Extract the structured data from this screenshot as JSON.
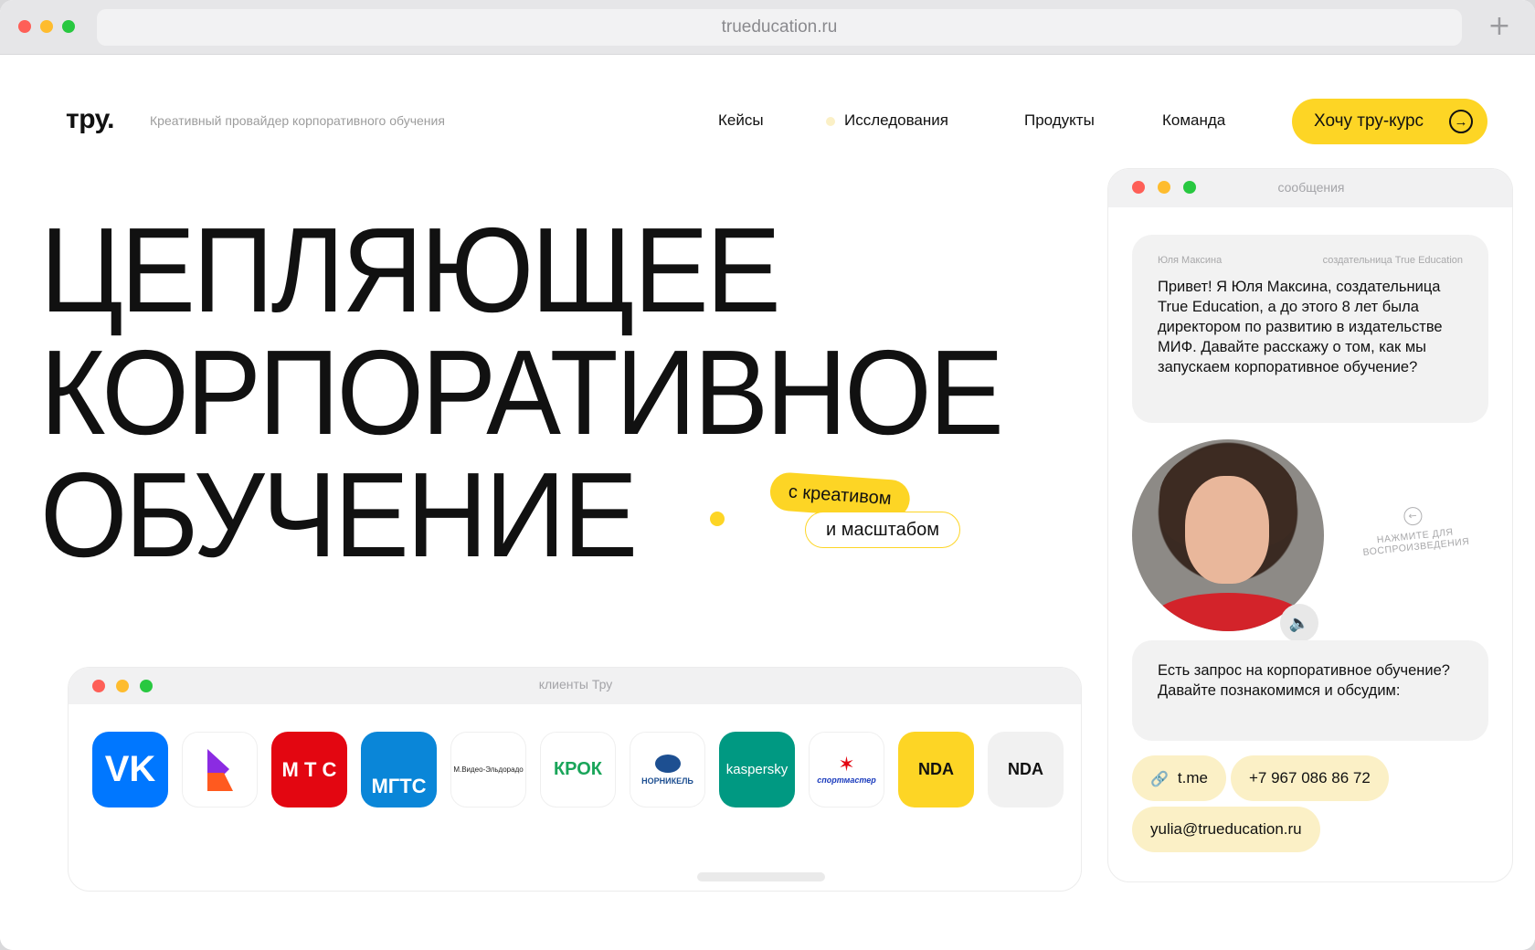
{
  "browser": {
    "url": "trueducation.ru",
    "new_tab_icon": "plus-icon"
  },
  "header": {
    "logo": "тру.",
    "tagline": "Креативный провайдер корпоративного обучения",
    "nav": [
      "Кейсы",
      "Исследования",
      "Продукты",
      "Команда"
    ],
    "cta_label": "Хочу тру-курс",
    "cta_icon": "arrow-right-circle-icon"
  },
  "hero": {
    "lines": [
      "ЦЕПЛЯЮЩЕЕ",
      "КОРПОРАТИВНОЕ",
      "ОБУЧЕНИЕ"
    ],
    "pill_1": "с креативом",
    "pill_2": "и масштабом"
  },
  "clients": {
    "title": "клиенты Тру",
    "logos": [
      {
        "name": "vk",
        "text": "VK",
        "bg": "#0077ff",
        "color": "#ffffff"
      },
      {
        "name": "kion",
        "text": "",
        "bg": "#ffffff",
        "color": "#8b2be2"
      },
      {
        "name": "mts",
        "text": "М Т С",
        "bg": "#e30611",
        "color": "#ffffff"
      },
      {
        "name": "mgts",
        "text": "МГТС",
        "bg": "#0a86d8",
        "color": "#ffffff"
      },
      {
        "name": "mvideo-eldorado",
        "text": "М.Видео-Эльдорадо",
        "bg": "#ffffff",
        "color": "#222222"
      },
      {
        "name": "krok",
        "text": "КРОК",
        "bg": "#ffffff",
        "color": "#1aa55a"
      },
      {
        "name": "nornickel",
        "text": "НОРНИКЕЛЬ",
        "bg": "#ffffff",
        "color": "#1d4f91"
      },
      {
        "name": "kaspersky",
        "text": "kaspersky",
        "bg": "#009982",
        "color": "#ffffff"
      },
      {
        "name": "sportmaster",
        "text": "спортмастер",
        "bg": "#ffffff",
        "color": "#1a3bbd"
      },
      {
        "name": "nda-yellow",
        "text": "NDA",
        "bg": "#fdd525",
        "color": "#111111"
      },
      {
        "name": "nda-gray",
        "text": "NDA",
        "bg": "#f1f1f1",
        "color": "#111111"
      }
    ]
  },
  "chat": {
    "title": "сообщения",
    "author": "Юля Максина",
    "author_role": "создательница True Education",
    "message_1": "Привет! Я Юля Максина, создательница True Education, а до этого 8 лет была директором по развитию в издательстве МИФ. Давайте расскажу о том, как мы запускаем корпоративное обучение?",
    "play_hint": "НАЖМИТЕ ДЛЯ ВОСПРОИЗВЕДЕНИЯ",
    "message_2": "Есть запрос на корпоративное обучение? Давайте познакомимся и обсудим:",
    "contacts": {
      "telegram": "t.me",
      "phone": "+7 967 086 86 72",
      "email": "yulia@trueducation.ru"
    }
  },
  "colors": {
    "accent": "#fdd525",
    "soft_accent": "#fbf0c6",
    "text": "#111111"
  }
}
